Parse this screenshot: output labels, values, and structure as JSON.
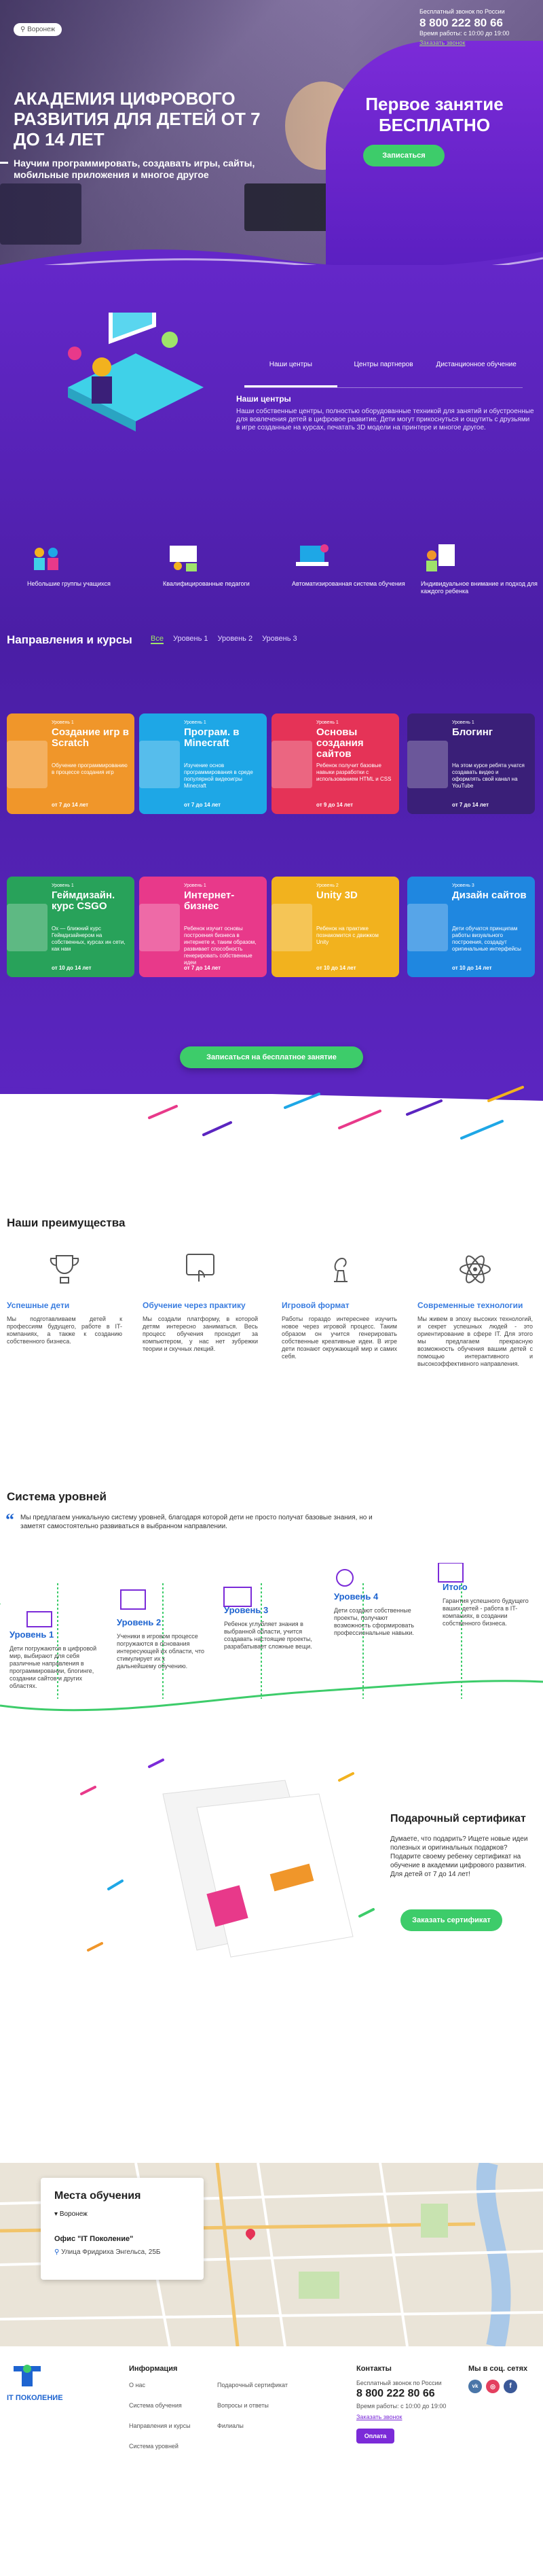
{
  "header": {
    "city": "Воронеж",
    "free_call_label": "Бесплатный звонок по России",
    "phone": "8 800 222 80 66",
    "hours": "Время работы: с 10:00 до 19:00",
    "callback_link": "Заказать звонок"
  },
  "hero": {
    "title": "АКАДЕМИЯ ЦИФРОВОГО РАЗВИТИЯ ДЛЯ ДЕТЕЙ ОТ 7 ДО 14 ЛЕТ",
    "subtitle": "Научим программировать, создавать игры, сайты, мобильные приложения и многое другое",
    "offer": "Первое занятие БЕСПЛАТНО",
    "signup_button": "Записаться"
  },
  "centers": {
    "tabs": [
      "Наши центры",
      "Центры партнеров",
      "Дистанционное обучение"
    ],
    "heading": "Наши центры",
    "text": "Наши собственные центры, полностью оборудованные техникой для занятий и обустроенные для вовлечения детей в цифровое развитие. Дети могут прикоснуться и ощутить с друзьями в игре созданные на курсах, печатать 3D модели на принтере и многое другое.",
    "features": [
      "Небольшие группы учащихся",
      "Квалифицированные педагоги",
      "Автоматизированная система обучения",
      "Индивидуальное внимание и подход для каждого ребенка"
    ]
  },
  "directions": {
    "heading": "Направления и курсы",
    "level_tabs": [
      "Все",
      "Уровень 1",
      "Уровень 2",
      "Уровень 3"
    ],
    "cards": [
      {
        "level": "Уровень 1",
        "title": "Создание игр в Scratch",
        "desc": "Обучение программированию в процессе создания игр",
        "age": "от 7 до 14 лет",
        "color": "#f0962a"
      },
      {
        "level": "Уровень 1",
        "title": "Програм. в Minecraft",
        "desc": "Изучение основ программирования в среде популярной видеоигры Minecraft",
        "age": "от 7 до 14 лет",
        "color": "#1ea7e6"
      },
      {
        "level": "Уровень 1",
        "title": "Основы создания сайтов",
        "desc": "Ребенок получит базовые навыки разработки с использованием HTML и CSS",
        "age": "от 9 до 14 лет",
        "color": "#e53357"
      },
      {
        "level": "Уровень 1",
        "title": "Блогинг",
        "desc": "На этом курсе ребята учатся создавать видео и оформлять свой канал на YouTube",
        "age": "от 7 до 14 лет",
        "color": "#3a1f78"
      },
      {
        "level": "Уровень 1",
        "title": "Геймдизайн. курс CSGO",
        "desc": "Ох — ближний курс Геймдизайнером на собственных, курсах ин сети, как нам",
        "age": "от 10 до 14 лет",
        "color": "#28a25a"
      },
      {
        "level": "Уровень 1",
        "title": "Интернет-бизнес",
        "desc": "Ребенок изучит основы построения бизнеса в интернете и, таким образом, развивает способность генерировать собственные идеи",
        "age": "от 7 до 14 лет",
        "color": "#e8398a"
      },
      {
        "level": "Уровень 2",
        "title": "Unity 3D",
        "desc": "Ребенок на практике познакомится с движком Unity",
        "age": "от 10 до 14 лет",
        "color": "#f2b21e"
      },
      {
        "level": "Уровень 3",
        "title": "Дизайн сайтов",
        "desc": "Дети обучатся принципам работы визуального построения, создадут оригинальные интерфейсы",
        "age": "от 10 до 14 лет",
        "color": "#1f87e0"
      }
    ],
    "cta": "Записаться на бесплатное занятие"
  },
  "advantages": {
    "heading": "Наши преимущества",
    "items": [
      {
        "title": "Успешные дети",
        "desc": "Мы подготавливаем детей к профессиям будущего, работе в IT-компаниях, а также к созданию собственного бизнеса."
      },
      {
        "title": "Обучение через практику",
        "desc": "Мы создали платформу, в которой детям интересно заниматься. Весь процесс обучения проходит за компьютером, у нас нет зубрежки теории и скучных лекций."
      },
      {
        "title": "Игровой формат",
        "desc": "Работы гораздо интереснее изучить новое через игровой процесс. Таким образом он учится генерировать собственные креативные идеи. В игре дети познают окружающий мир и самих себя."
      },
      {
        "title": "Современные технологии",
        "desc": "Мы живем в эпоху высоких технологий, и секрет успешных людей - это ориентирование в сфере IT. Для этого мы предлагаем прекрасную возможность обучения вашим детей с помощью интерактивного и высокоэффективного направления."
      }
    ]
  },
  "levels": {
    "heading": "Система уровней",
    "intro": "Мы предлагаем уникальную систему уровней, благодаря которой дети не просто получат базовые знания, но и заметят самостоятельно развиваться в выбранном направлении.",
    "steps": [
      {
        "title": "Уровень 1",
        "desc": "Дети погружаются в цифровой мир, выбирают для себя различные направления в программировании, блогинге, создании сайтов и других областях."
      },
      {
        "title": "Уровень 2",
        "desc": "Ученики в игровом процессе погружаются в основания интересующей их области, что стимулирует их к дальнейшему обучению."
      },
      {
        "title": "Уровень 3",
        "desc": "Ребенок углубляет знания в выбранной области, учится создавать настоящие проекты, разрабатывает сложные вещи."
      },
      {
        "title": "Уровень 4",
        "desc": "Дети создают собственные проекты, получают возможность сформировать профессиональные навыки."
      },
      {
        "title": "Итого",
        "desc": "Гарантия успешного будущего ваших детей - работа в IT-компаниях, в создании собственного бизнеса."
      }
    ]
  },
  "certificate": {
    "heading": "Подарочный сертификат",
    "text": "Думаете, что подарить? Ищете новые идеи полезных и оригинальных подарков? Подарите своему ребенку сертификат на обучение в академии цифрового развития. Для детей от 7 до 14 лет!",
    "button": "Заказать сертификат"
  },
  "locations": {
    "heading": "Места обучения",
    "city": "Воронеж",
    "office": "Офис \"IT Поколение\"",
    "address": "Улица Фридриха Энгельса, 25Б"
  },
  "footer": {
    "logo_text": "IT ПОКОЛЕНИЕ",
    "info_heading": "Информация",
    "links_col1": [
      "О нас",
      "Система обучения",
      "Направления и курсы",
      "Система уровней"
    ],
    "links_col2": [
      "Подарочный сертификат",
      "Вопросы и ответы",
      "Филиалы"
    ],
    "contacts_heading": "Контакты",
    "free_call": "Бесплатный звонок по России",
    "phone": "8 800 222 80 66",
    "hours": "Время работы: с 10:00 до 19:00",
    "callback": "Заказать звонок",
    "social_heading": "Мы в соц. сетях",
    "pay_button": "Оплата"
  }
}
